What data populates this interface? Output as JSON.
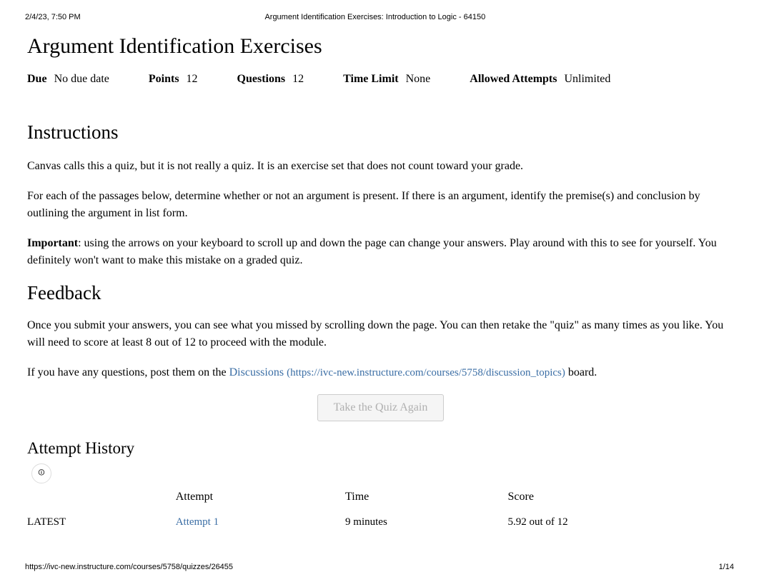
{
  "header": {
    "timestamp": "2/4/23, 7:50 PM",
    "title": "Argument Identification Exercises: Introduction to Logic - 64150"
  },
  "page_title": "Argument Identification Exercises",
  "meta": {
    "due_label": "Due",
    "due_value": "No due date",
    "points_label": "Points",
    "points_value": "12",
    "questions_label": "Questions",
    "questions_value": "12",
    "timelimit_label": "Time Limit",
    "timelimit_value": "None",
    "attempts_label": "Allowed Attempts",
    "attempts_value": "Unlimited"
  },
  "instructions": {
    "heading": "Instructions",
    "p1": "Canvas calls this a quiz, but it is not really a quiz. It is an exercise set that does not count toward your grade.",
    "p2": "For each of the passages below, determine whether or not an argument is present. If there is an argument, identify the premise(s) and conclusion by outlining the argument in list form.",
    "important_label": "Important",
    "p3_rest": ": using the arrows on your keyboard to scroll up and down the page can change your answers. Play around with this to see for yourself. You definitely won't want to make this mistake on a graded quiz."
  },
  "feedback": {
    "heading": "Feedback",
    "p1": "Once you submit your answers, you can see what you missed by scrolling down the page. You can then retake the \"quiz\" as many times as you like. You will need to score at least 8 out of 12 to proceed with the module.",
    "p2_before": "If you have any questions, post them on the ",
    "link_text": "Discussions",
    "link_url": "(https://ivc-new.instructure.com/courses/5758/discussion_topics)",
    "p2_after": " board."
  },
  "button_label": "Take the Quiz Again",
  "attempt_history": {
    "heading": "Attempt History",
    "icon": "🛈",
    "col_status": "",
    "col_attempt": "Attempt",
    "col_time": "Time",
    "col_score": "Score",
    "row": {
      "status": "LATEST",
      "attempt": "Attempt 1",
      "time": "9 minutes",
      "score": "5.92 out of 12"
    }
  },
  "footer": {
    "url": "https://ivc-new.instructure.com/courses/5758/quizzes/26455",
    "page": "1/14"
  }
}
